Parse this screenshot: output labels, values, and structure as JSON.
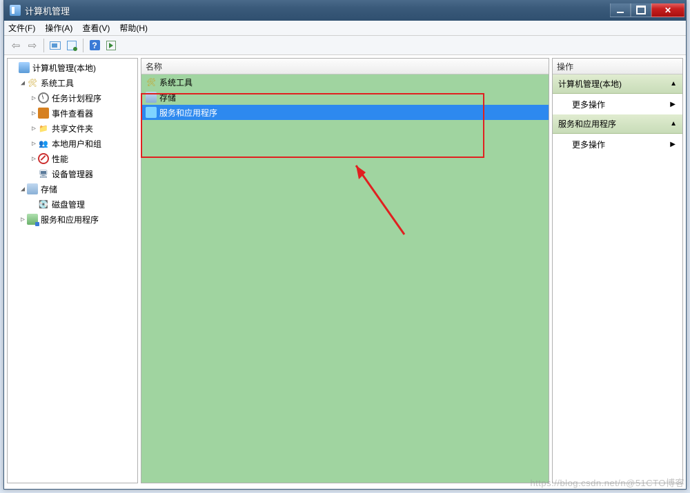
{
  "window": {
    "title": "计算机管理"
  },
  "menu": {
    "file": "文件(F)",
    "action": "操作(A)",
    "view": "查看(V)",
    "help": "帮助(H)"
  },
  "tree": {
    "root": "计算机管理(本地)",
    "sys_tools": "系统工具",
    "task_sched": "任务计划程序",
    "event_viewer": "事件查看器",
    "shared_folders": "共享文件夹",
    "local_users": "本地用户和组",
    "performance": "性能",
    "device_mgr": "设备管理器",
    "storage": "存储",
    "disk_mgmt": "磁盘管理",
    "services_apps": "服务和应用程序"
  },
  "list": {
    "header": "名称",
    "row_sys_tools": "系统工具",
    "row_storage": "存储",
    "row_services": "服务和应用程序"
  },
  "actions": {
    "header": "操作",
    "group1": "计算机管理(本地)",
    "more1": "更多操作",
    "group2": "服务和应用程序",
    "more2": "更多操作"
  },
  "watermark": "https://blog.csdn.net/n@51CTO博客"
}
